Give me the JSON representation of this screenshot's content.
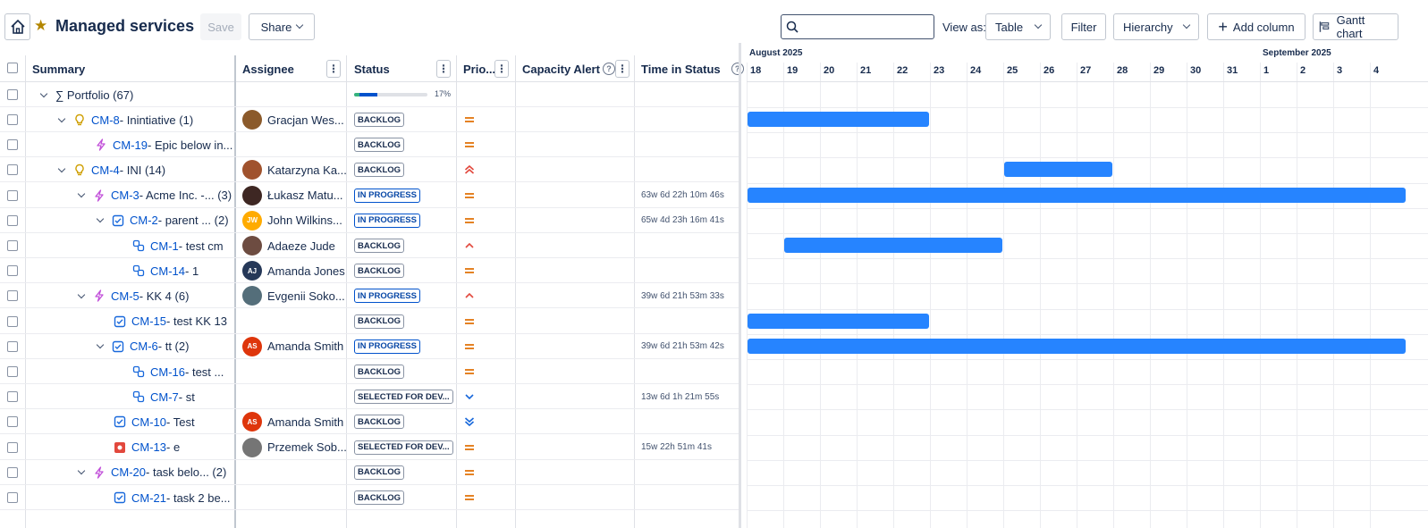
{
  "toolbar": {
    "title": "Managed services",
    "save_label": "Save",
    "share_label": "Share",
    "search_placeholder": "",
    "view_as_label": "View as:",
    "view_as_value": "Table",
    "filter_label": "Filter",
    "hierarchy_value": "Hierarchy",
    "add_column_label": "Add column",
    "gantt_label": "Gantt chart"
  },
  "columns": {
    "summary": "Summary",
    "assignee": "Assignee",
    "status": "Status",
    "priority": "Prio...",
    "capacity": "Capacity Alert",
    "time_in_status": "Time in Status"
  },
  "portfolio": {
    "label": "∑ Portfolio (67)",
    "progress": 0.17,
    "progress_label": "17%"
  },
  "colors": {
    "blue": "#2684ff",
    "green": "#36b37e",
    "darkblue": "#0052cc"
  },
  "rows": [
    {
      "key": "CM-8",
      "title": " - Inintiative (1)",
      "icon": "idea-icon",
      "toggle": true,
      "assignee": "Gracjan Wes...",
      "avatar": "photo",
      "avatar_color": "#8b5a2b",
      "status": "BACKLOG",
      "prio": "medium",
      "tis": ""
    },
    {
      "key": "CM-19",
      "title": " - Epic below in...",
      "icon": "epic-icon",
      "toggle": false,
      "assignee": "",
      "avatar": "",
      "avatar_color": "",
      "status": "BACKLOG",
      "prio": "medium",
      "tis": ""
    },
    {
      "key": "CM-4",
      "title": " - INI (14)",
      "icon": "idea-icon",
      "toggle": true,
      "assignee": "Katarzyna Ka...",
      "avatar": "photo",
      "avatar_color": "#a0522d",
      "status": "BACKLOG",
      "prio": "highest",
      "tis": ""
    },
    {
      "key": "CM-3",
      "title": " - Acme Inc. -... (3)",
      "icon": "epic-icon",
      "toggle": true,
      "assignee": "Łukasz Matu...",
      "avatar": "photo",
      "avatar_color": "#3e2723",
      "status": "IN PROGRESS",
      "prio": "medium",
      "tis": "63w 6d 22h 10m 46s"
    },
    {
      "key": "CM-2",
      "title": " - parent ... (2)",
      "icon": "task-icon",
      "toggle": true,
      "assignee": "John Wilkins...",
      "avatar": "JW",
      "avatar_color": "#ffab00",
      "status": "IN PROGRESS",
      "prio": "medium",
      "tis": "65w 4d 23h 16m 41s"
    },
    {
      "key": "CM-1",
      "title": " - test cm",
      "icon": "subtask-icon",
      "toggle": false,
      "assignee": "Adaeze Jude",
      "avatar": "photo",
      "avatar_color": "#6d4c41",
      "status": "BACKLOG",
      "prio": "high",
      "tis": ""
    },
    {
      "key": "CM-14",
      "title": " - 1",
      "icon": "subtask-icon",
      "toggle": false,
      "assignee": "Amanda Jones",
      "avatar": "AJ",
      "avatar_color": "#253858",
      "status": "BACKLOG",
      "prio": "medium",
      "tis": ""
    },
    {
      "key": "CM-5",
      "title": " - KK 4 (6)",
      "icon": "epic-icon",
      "toggle": true,
      "assignee": "Evgenii Soko...",
      "avatar": "photo",
      "avatar_color": "#546e7a",
      "status": "IN PROGRESS",
      "prio": "high",
      "tis": "39w 6d 21h 53m 33s"
    },
    {
      "key": "CM-15",
      "title": " - test KK 13",
      "icon": "task-icon",
      "toggle": false,
      "assignee": "",
      "avatar": "",
      "avatar_color": "",
      "status": "BACKLOG",
      "prio": "medium",
      "tis": ""
    },
    {
      "key": "CM-6",
      "title": " - tt (2)",
      "icon": "task-icon",
      "toggle": true,
      "assignee": "Amanda Smith",
      "avatar": "AS",
      "avatar_color": "#de350b",
      "status": "IN PROGRESS",
      "prio": "medium",
      "tis": "39w 6d 21h 53m 42s"
    },
    {
      "key": "CM-16",
      "title": " - test ...",
      "icon": "subtask-icon",
      "toggle": false,
      "assignee": "",
      "avatar": "",
      "avatar_color": "",
      "status": "BACKLOG",
      "prio": "medium",
      "tis": ""
    },
    {
      "key": "CM-7",
      "title": " - st",
      "icon": "subtask-icon",
      "toggle": false,
      "assignee": "",
      "avatar": "",
      "avatar_color": "",
      "status": "SELECTED FOR DEV...",
      "prio": "low",
      "tis": "13w 6d 1h 21m 55s"
    },
    {
      "key": "CM-10",
      "title": " - Test",
      "icon": "task-icon",
      "toggle": false,
      "assignee": "Amanda Smith",
      "avatar": "AS",
      "avatar_color": "#de350b",
      "status": "BACKLOG",
      "prio": "lowest",
      "tis": ""
    },
    {
      "key": "CM-13",
      "title": " - e",
      "icon": "bug-icon",
      "toggle": false,
      "assignee": "Przemek Sob...",
      "avatar": "photo",
      "avatar_color": "#757575",
      "status": "SELECTED FOR DEV...",
      "prio": "medium",
      "tis": "15w 22h 51m 41s"
    },
    {
      "key": "CM-20",
      "title": " - task belo... (2)",
      "icon": "epic-icon",
      "toggle": true,
      "assignee": "",
      "avatar": "",
      "avatar_color": "",
      "status": "BACKLOG",
      "prio": "medium",
      "tis": ""
    },
    {
      "key": "CM-21",
      "title": " - task 2 be...",
      "icon": "task-icon",
      "toggle": false,
      "assignee": "",
      "avatar": "",
      "avatar_color": "",
      "status": "BACKLOG",
      "prio": "medium",
      "tis": ""
    }
  ],
  "gantt": {
    "months": [
      "August 2025",
      "September 2025"
    ],
    "days": [
      "18",
      "19",
      "20",
      "21",
      "22",
      "23",
      "24",
      "25",
      "26",
      "27",
      "28",
      "29",
      "30",
      "31",
      "1",
      "2",
      "3",
      "4"
    ],
    "bars": [
      {
        "row": 0,
        "start": 0,
        "end": 5
      },
      {
        "row": 2,
        "start": 7,
        "end": 10
      },
      {
        "row": 3,
        "start": 0,
        "end": 18
      },
      {
        "row": 5,
        "start": 1,
        "end": 7
      },
      {
        "row": 8,
        "start": 0,
        "end": 5
      },
      {
        "row": 9,
        "start": 0,
        "end": 18
      }
    ]
  }
}
